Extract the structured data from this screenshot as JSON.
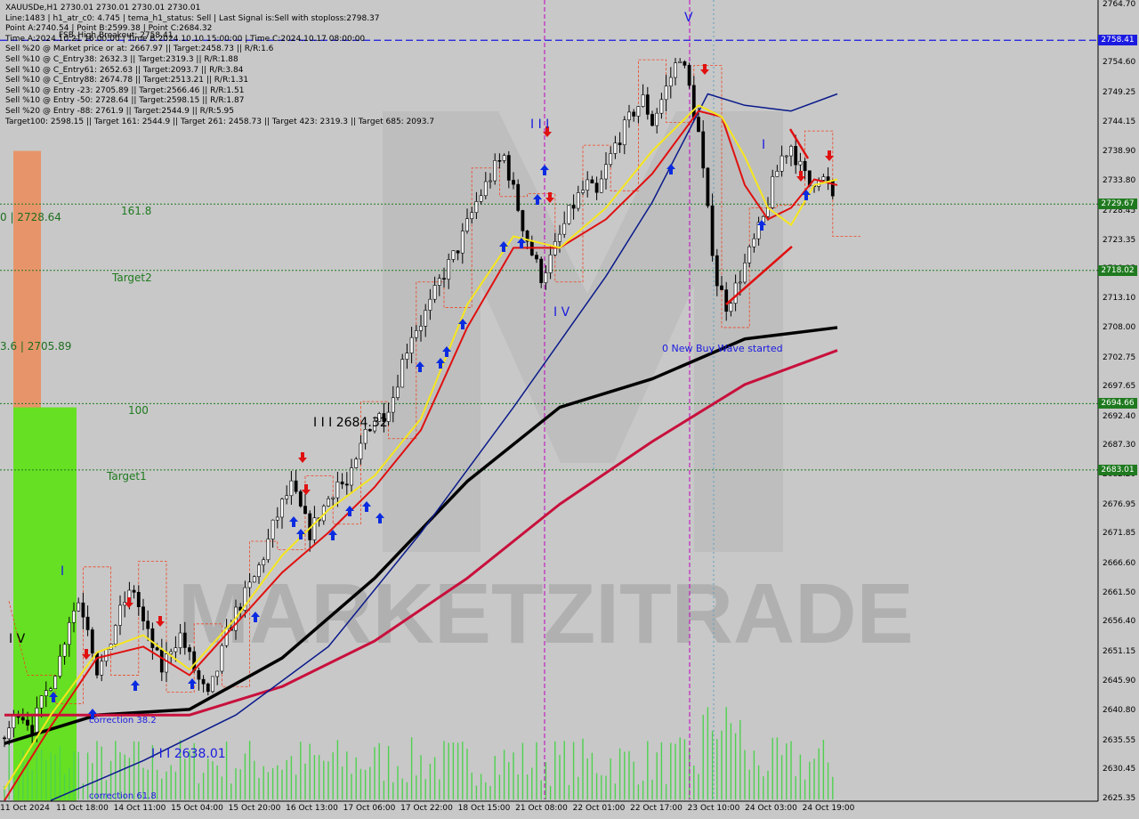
{
  "symbol": "XAUUSDe,H1",
  "info_lines": [
    "XAUUSDe,H1  2730.01 2730.01 2730.01 2730.01",
    "Line:1483 | h1_atr_c0: 4.745 | tema_h1_status: Sell | Last Signal is:Sell with stoploss:2798.37",
    "Point A:2740.54 | Point B:2599.38 | Point C:2684.32",
    "Time A:2024.10.21 16:00:00 | Time B:2024.10.10 15:00:00 | Time C:2024.10.17 08:00:00",
    "Sell %20 @ Market price or at: 2667.97 || Target:2458.73 || R/R:1.6",
    "Sell %10 @ C_Entry38: 2632.3 || Target:2319.3 || R/R:1.88",
    "Sell %10 @ C_Entry61: 2652.63 || Target:2093.7 || R/R:3.84",
    "Sell %10 @ C_Entry88: 2674.78 || Target:2513.21 || R/R:1.31",
    "Sell %10 @ Entry -23: 2705.89 || Target:2566.46 || R/R:1.51",
    "Sell %10 @ Entry -50: 2728.64 || Target:2598.15 || R/R:1.87",
    "Sell %20 @ Entry -88: 2761.9 || Target:2544.9 || R/R:5.95",
    "Target100: 2598.15 || Target 161: 2544.9 || Target 261: 2458.73 || Target 423: 2319.3 || Target 685: 2093.7"
  ],
  "overlay_labels": {
    "fsb": "FSB_High Breakout: 2758.41",
    "lvl_2728": "0 | 2728.64",
    "lvl_2705": "3.6 | 2705.89",
    "lvl_2684": "I I I 2684.32",
    "lvl_2638": "I I I 2638.01",
    "fib_1618": "161.8",
    "target2": "Target2",
    "fib_100": "100",
    "target1": "Target1",
    "corr_382": "correction 38.2",
    "corr_618": "correction 61.8",
    "new_wave": "0 New Buy Wave started",
    "wave_I": "I",
    "wave_IV_left": "I V",
    "wave_III": "I I I",
    "wave_IV": "I V",
    "wave_V": "V",
    "wave_I_right": "I",
    "watermark": "MARKETZITRADE"
  },
  "colors": {
    "background": "#c8c8c8",
    "candle": "#000000",
    "bull_zone": "#66e022",
    "bear_zone": "#e8946a",
    "sma_black": "#000000",
    "sma_crimson": "#c8103c",
    "ma_navy": "#0a1a8a",
    "ema_red": "#e01010",
    "ema_yellow": "#f5e61e",
    "volume": "#4fd14f",
    "level_green": "#1f7a1f",
    "level_blue": "#1a1ae0",
    "vline_magenta": "#c000c0",
    "arrow_up": "#0a2be0",
    "arrow_down": "#e01010",
    "stop_dashed": "#ee4422"
  },
  "chart_data": {
    "type": "candlestick",
    "title": "XAUUSDe,H1",
    "ylim": [
      2625.35,
      2764.7
    ],
    "price_ticks": [
      "2764.70",
      "2754.60",
      "2749.25",
      "2744.15",
      "2738.90",
      "2733.80",
      "2728.45",
      "2723.35",
      "2718.25",
      "2713.10",
      "2708.00",
      "2702.75",
      "2697.65",
      "2692.40",
      "2687.30",
      "2682.20",
      "2676.95",
      "2671.85",
      "2666.60",
      "2661.50",
      "2656.40",
      "2651.15",
      "2645.90",
      "2640.80",
      "2635.55",
      "2630.45",
      "2625.35"
    ],
    "time_ticks": [
      "11 Oct 2024",
      "11 Oct 18:00",
      "14 Oct 11:00",
      "15 Oct 04:00",
      "15 Oct 20:00",
      "16 Oct 13:00",
      "17 Oct 06:00",
      "17 Oct 22:00",
      "18 Oct 15:00",
      "21 Oct 08:00",
      "22 Oct 01:00",
      "22 Oct 17:00",
      "23 Oct 10:00",
      "24 Oct 03:00",
      "24 Oct 19:00"
    ],
    "levels": [
      {
        "price": 2758.41,
        "label": "2758.41",
        "color": "#1a1ae0",
        "style": "dashed"
      },
      {
        "price": 2729.67,
        "label": "2729.67",
        "color": "#1f7a1f",
        "style": "dotted"
      },
      {
        "price": 2718.02,
        "label": "2718.02",
        "color": "#1f7a1f",
        "style": "dotted"
      },
      {
        "price": 2694.66,
        "label": "2694.66",
        "color": "#1f7a1f",
        "style": "dotted"
      },
      {
        "price": 2683.01,
        "label": "2683.01",
        "color": "#1f7a1f",
        "style": "dotted"
      }
    ],
    "close_path": [
      [
        0,
        2636
      ],
      [
        3,
        2641
      ],
      [
        6,
        2638
      ],
      [
        9,
        2644
      ],
      [
        12,
        2650
      ],
      [
        14,
        2657
      ],
      [
        16,
        2660
      ],
      [
        18,
        2656
      ],
      [
        20,
        2648
      ],
      [
        22,
        2650
      ],
      [
        24,
        2656
      ],
      [
        26,
        2660
      ],
      [
        28,
        2662
      ],
      [
        30,
        2656
      ],
      [
        32,
        2652
      ],
      [
        34,
        2648
      ],
      [
        36,
        2652
      ],
      [
        38,
        2654
      ],
      [
        40,
        2650
      ],
      [
        42,
        2646
      ],
      [
        44,
        2643
      ],
      [
        46,
        2648
      ],
      [
        48,
        2654
      ],
      [
        50,
        2658
      ],
      [
        52,
        2661
      ],
      [
        54,
        2664
      ],
      [
        56,
        2668
      ],
      [
        58,
        2673
      ],
      [
        60,
        2677
      ],
      [
        62,
        2680
      ],
      [
        64,
        2676
      ],
      [
        66,
        2672
      ],
      [
        68,
        2675
      ],
      [
        70,
        2678
      ],
      [
        72,
        2681
      ],
      [
        74,
        2680
      ],
      [
        76,
        2684
      ],
      [
        78,
        2690
      ],
      [
        80,
        2692
      ],
      [
        82,
        2693
      ],
      [
        84,
        2696
      ],
      [
        86,
        2702
      ],
      [
        88,
        2707
      ],
      [
        90,
        2709
      ],
      [
        92,
        2712
      ],
      [
        94,
        2716
      ],
      [
        96,
        2719
      ],
      [
        98,
        2722
      ],
      [
        100,
        2726
      ],
      [
        102,
        2730
      ],
      [
        104,
        2733
      ],
      [
        106,
        2736
      ],
      [
        108,
        2738
      ],
      [
        110,
        2732
      ],
      [
        112,
        2726
      ],
      [
        114,
        2721
      ],
      [
        116,
        2717
      ],
      [
        118,
        2720
      ],
      [
        120,
        2724
      ],
      [
        122,
        2728
      ],
      [
        124,
        2731
      ],
      [
        126,
        2733
      ],
      [
        128,
        2731
      ],
      [
        130,
        2736
      ],
      [
        132,
        2740
      ],
      [
        134,
        2743
      ],
      [
        136,
        2746
      ],
      [
        138,
        2748
      ],
      [
        140,
        2744
      ],
      [
        142,
        2748
      ],
      [
        144,
        2752
      ],
      [
        146,
        2756
      ],
      [
        148,
        2750
      ],
      [
        150,
        2742
      ],
      [
        152,
        2728
      ],
      [
        154,
        2716
      ],
      [
        156,
        2712
      ],
      [
        158,
        2715
      ],
      [
        160,
        2719
      ],
      [
        162,
        2723
      ],
      [
        164,
        2727
      ],
      [
        166,
        2733
      ],
      [
        168,
        2738
      ],
      [
        170,
        2740
      ],
      [
        172,
        2736
      ],
      [
        174,
        2733
      ],
      [
        176,
        2735
      ],
      [
        178,
        2733
      ],
      [
        179,
        2730
      ]
    ],
    "series": [
      {
        "name": "",
        "color": "#000000",
        "values": [
          [
            0,
            2635
          ],
          [
            20,
            2640
          ],
          [
            40,
            2641
          ],
          [
            60,
            2650
          ],
          [
            80,
            2664
          ],
          [
            100,
            2681
          ],
          [
            120,
            2694
          ],
          [
            140,
            2699
          ],
          [
            160,
            2706
          ],
          [
            180,
            2708
          ]
        ]
      },
      {
        "name": "",
        "color": "#c8103c",
        "values": [
          [
            0,
            2640
          ],
          [
            40,
            2640
          ],
          [
            60,
            2645
          ],
          [
            80,
            2653
          ],
          [
            100,
            2664
          ],
          [
            120,
            2677
          ],
          [
            140,
            2688
          ],
          [
            160,
            2698
          ],
          [
            180,
            2704
          ]
        ]
      },
      {
        "name": "",
        "color": "#0a1a8a",
        "values": [
          [
            10,
            2625
          ],
          [
            30,
            2632
          ],
          [
            50,
            2640
          ],
          [
            70,
            2652
          ],
          [
            90,
            2672
          ],
          [
            110,
            2694
          ],
          [
            130,
            2717
          ],
          [
            140,
            2730
          ],
          [
            152,
            2749
          ],
          [
            160,
            2747
          ],
          [
            170,
            2746
          ],
          [
            180,
            2749
          ]
        ]
      },
      {
        "name": "",
        "color": "#e01010",
        "values": [
          [
            0,
            2625
          ],
          [
            10,
            2638
          ],
          [
            20,
            2650
          ],
          [
            30,
            2652
          ],
          [
            40,
            2647
          ],
          [
            50,
            2656
          ],
          [
            60,
            2665
          ],
          [
            70,
            2672
          ],
          [
            80,
            2680
          ],
          [
            90,
            2690
          ],
          [
            100,
            2708
          ],
          [
            110,
            2722
          ],
          [
            120,
            2722
          ],
          [
            130,
            2727
          ],
          [
            140,
            2735
          ],
          [
            150,
            2746
          ],
          [
            155,
            2745
          ],
          [
            160,
            2733
          ],
          [
            165,
            2727
          ],
          [
            170,
            2729
          ],
          [
            175,
            2734
          ],
          [
            180,
            2733
          ]
        ]
      },
      {
        "name": "",
        "color": "#f5e61e",
        "values": [
          [
            0,
            2627
          ],
          [
            10,
            2640
          ],
          [
            20,
            2651
          ],
          [
            30,
            2654
          ],
          [
            40,
            2648
          ],
          [
            50,
            2657
          ],
          [
            60,
            2668
          ],
          [
            70,
            2676
          ],
          [
            80,
            2682
          ],
          [
            90,
            2692
          ],
          [
            100,
            2712
          ],
          [
            110,
            2724
          ],
          [
            120,
            2722
          ],
          [
            130,
            2729
          ],
          [
            140,
            2739
          ],
          [
            150,
            2747
          ],
          [
            155,
            2745
          ],
          [
            160,
            2738
          ],
          [
            165,
            2729
          ],
          [
            170,
            2726
          ],
          [
            175,
            2733
          ],
          [
            180,
            2734
          ]
        ]
      }
    ],
    "zones": [
      {
        "name": "bear-zone",
        "price_from": 2739,
        "price_to": 2677
      },
      {
        "name": "bull-zone",
        "price_from": 2694,
        "price_to": 2625
      }
    ],
    "legend": "none",
    "grid": false
  }
}
